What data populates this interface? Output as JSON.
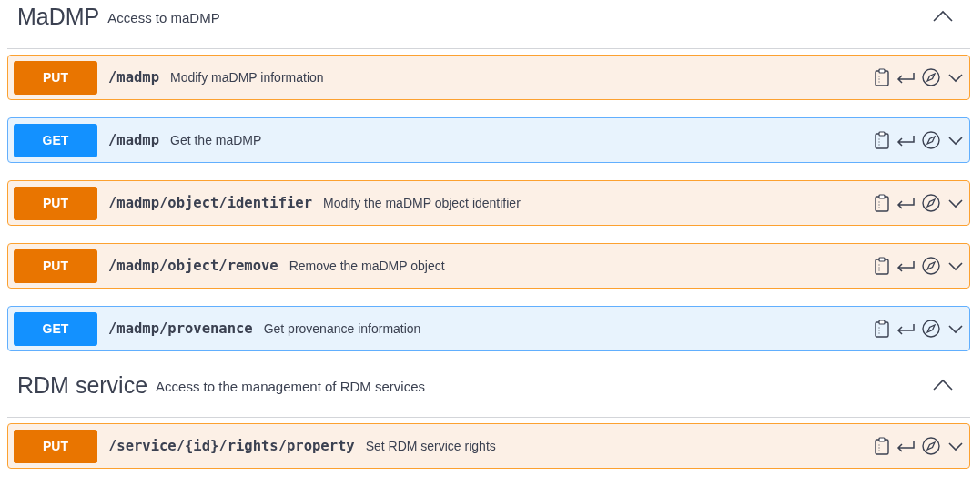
{
  "sections": [
    {
      "name": "MaDMP",
      "description": "Access to maDMP",
      "expanded": true,
      "operations": [
        {
          "method": "PUT",
          "kind": "put",
          "path": "/madmp",
          "summary": "Modify maDMP information"
        },
        {
          "method": "GET",
          "kind": "get",
          "path": "/madmp",
          "summary": "Get the maDMP"
        },
        {
          "method": "PUT",
          "kind": "put",
          "path": "/madmp/object/identifier",
          "summary": "Modify the maDMP object identifier"
        },
        {
          "method": "PUT",
          "kind": "put",
          "path": "/madmp/object/remove",
          "summary": "Remove the maDMP object"
        },
        {
          "method": "GET",
          "kind": "get",
          "path": "/madmp/provenance",
          "summary": "Get provenance information"
        }
      ]
    },
    {
      "name": "RDM service",
      "description": "Access to the management of RDM services",
      "expanded": true,
      "operations": [
        {
          "method": "PUT",
          "kind": "put",
          "path": "/service/{id}/rights/property",
          "summary": "Set RDM service rights"
        }
      ]
    }
  ]
}
